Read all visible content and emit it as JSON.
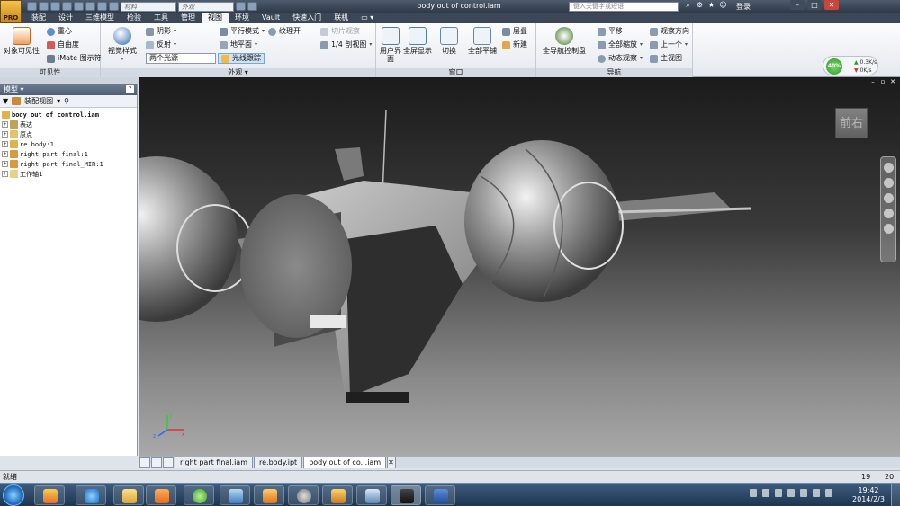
{
  "window": {
    "logo_label": "PRO",
    "title": "body out of control.iam",
    "qat_material": "材料",
    "qat_appearance": "外观",
    "search_placeholder": "键入关键字或短语",
    "login_label": "登录"
  },
  "ribbon_tabs": [
    "装配",
    "设计",
    "三维模型",
    "检验",
    "工具",
    "管理",
    "视图",
    "环境",
    "Vault",
    "快速入门",
    "联机"
  ],
  "active_tab": "视图",
  "ribbon": {
    "visibility": {
      "object_visibility": "对象可见性",
      "center_of_gravity": "重心",
      "dof": "自由度",
      "imate_glyph": "iMate 图示符",
      "footer": "可见性"
    },
    "appearance": {
      "visual_style": "视觉样式",
      "shadows": "阴影",
      "reflection": "反射",
      "lighting_combo": "两个光源",
      "parallel_mode": "平行模式",
      "ground_plane": "地平面",
      "ray_tracing": "光线跟踪",
      "texture_on": "纹理开",
      "slice_graphics": "切片观察",
      "quarter_section": "1/4 剖视图",
      "footer": "外观"
    },
    "windows": {
      "user_interface": "用户界面",
      "fullscreen": "全屏显示",
      "switch": "切换",
      "tile_all": "全部平铺",
      "cascade": "层叠",
      "new": "新建",
      "footer": "窗口"
    },
    "navigate": {
      "full_nav_wheel": "全导航控制盘",
      "pan": "平移",
      "zoom_all": "全部缩放",
      "orbit": "动态观察",
      "look_at": "观察方向",
      "previous": "上一个",
      "home_view": "主视图",
      "footer": "导航"
    },
    "network": {
      "percent": "40%",
      "up": "0.3K/s",
      "down": "0K/s"
    }
  },
  "browser": {
    "title": "模型",
    "help": "?",
    "view_selector": "装配视图",
    "tree": [
      {
        "label": "body out of control.iam",
        "level": 0,
        "expander": "",
        "bold": true
      },
      {
        "label": "表达",
        "level": 1,
        "expander": "+"
      },
      {
        "label": "原点",
        "level": 1,
        "expander": "+"
      },
      {
        "label": "re.body:1",
        "level": 1,
        "expander": "+"
      },
      {
        "label": "right part final:1",
        "level": 1,
        "expander": "+"
      },
      {
        "label": "right part final_MIR:1",
        "level": 1,
        "expander": "+"
      },
      {
        "label": "工作轴1",
        "level": 1,
        "expander": "+"
      }
    ]
  },
  "viewcube": {
    "label": "前右"
  },
  "triad": {
    "x": "x",
    "y": "y",
    "z": "z"
  },
  "document_tabs": [
    "right part final.iam",
    "re.body.ipt",
    "body out of co...iam"
  ],
  "active_document": "body out of co...iam",
  "status": {
    "text": "就绪",
    "n1": "19",
    "n2": "20"
  },
  "taskbar": {
    "time": "19:42",
    "date": "2014/2/3"
  },
  "colors": {
    "titlebar": "#2f3a48",
    "ribbon_bg": "#e5e9ef",
    "viewport_top": "#1b1b1b",
    "viewport_bottom": "#a9a9a9",
    "taskbar": "#1d3550"
  }
}
